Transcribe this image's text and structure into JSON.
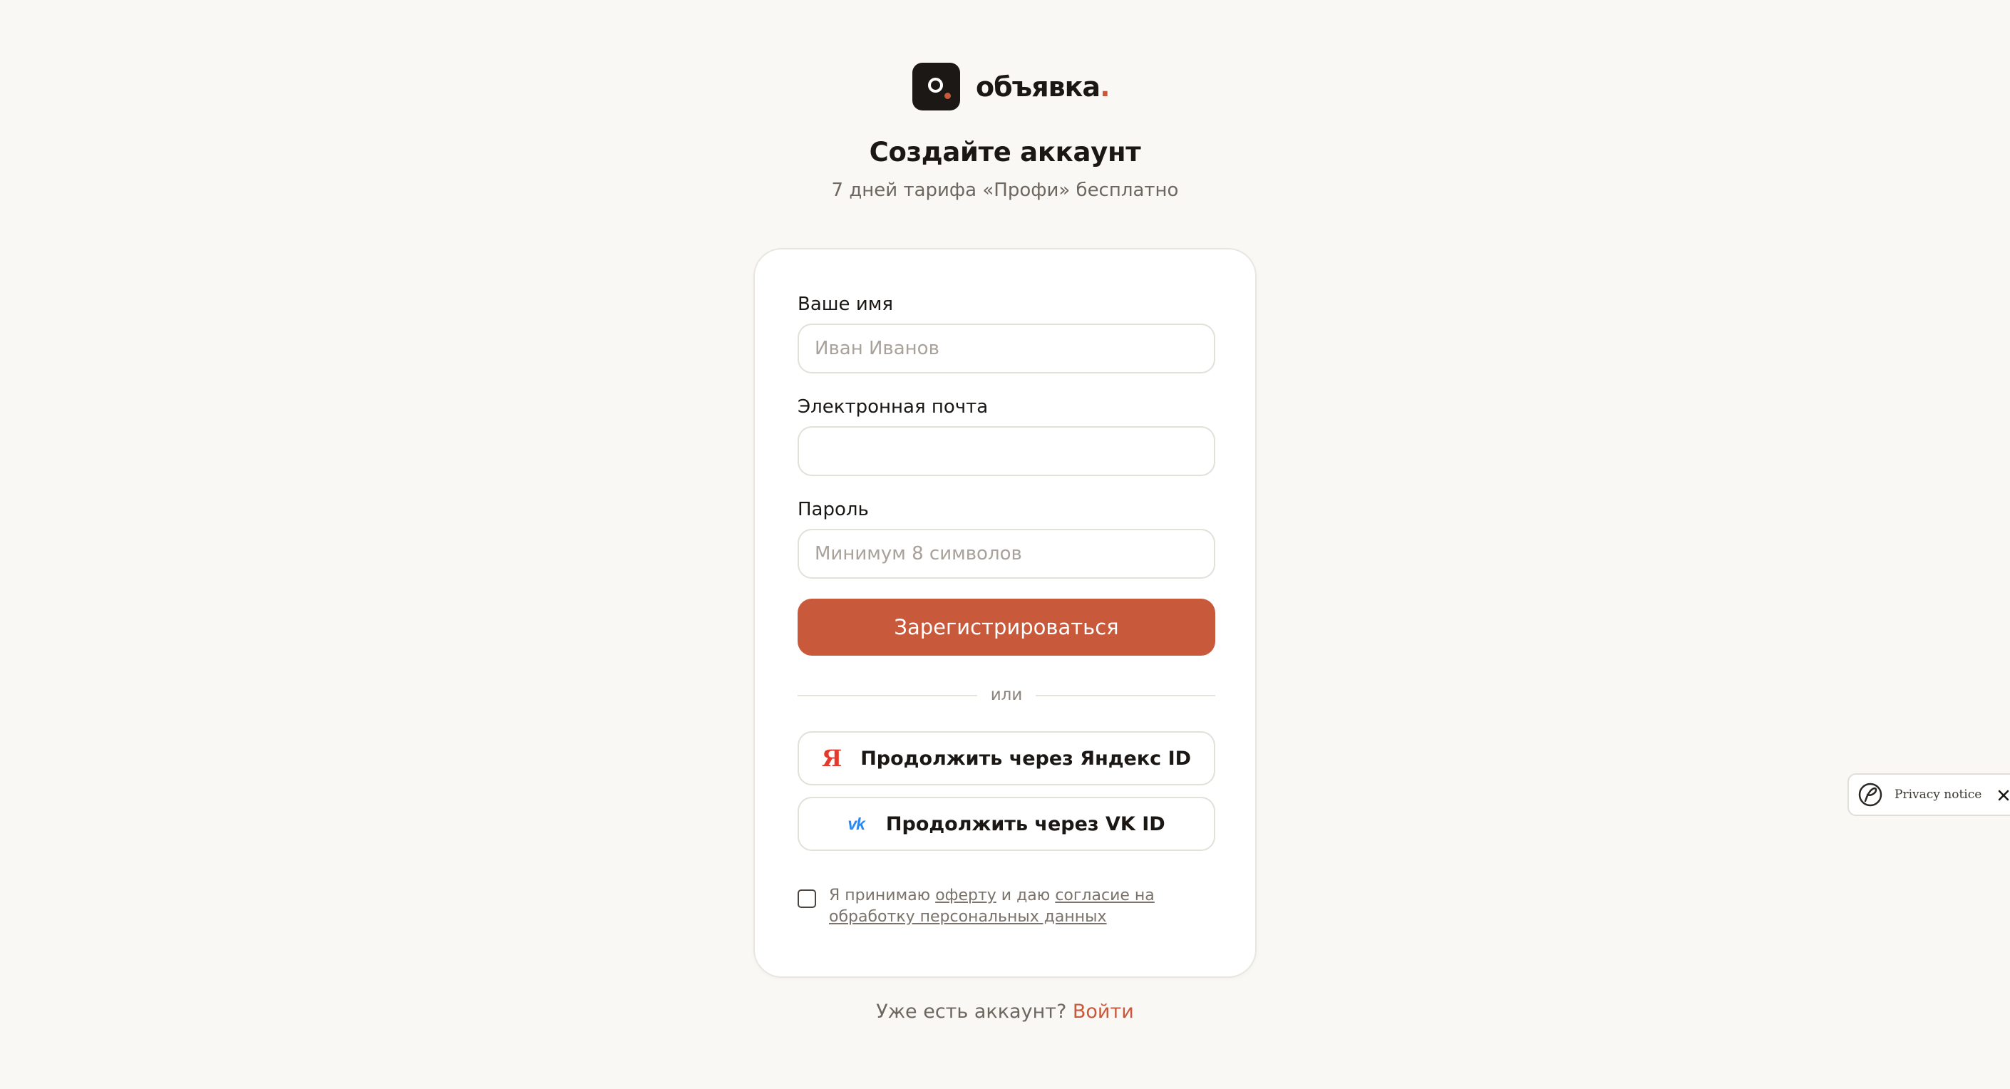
{
  "brand": {
    "name": "объявка",
    "accent_dot": ".",
    "accent_color": "#c8593b"
  },
  "header": {
    "title": "Создайте аккаунт",
    "subtitle": "7 дней тарифа «Профи» бесплатно"
  },
  "form": {
    "name": {
      "label": "Ваше имя",
      "placeholder": "Иван Иванов",
      "value": ""
    },
    "email": {
      "label": "Электронная почта",
      "placeholder": "",
      "value": ""
    },
    "password": {
      "label": "Пароль",
      "placeholder": "Минимум 8 символов",
      "value": ""
    },
    "submit_label": "Зарегистрироваться",
    "divider_text": "или",
    "yandex": {
      "icon": "Я",
      "label": "Продолжить через Яндекс ID"
    },
    "vk": {
      "icon": "vk",
      "label": "Продолжить через VK ID"
    },
    "consent": {
      "checked": false,
      "prefix": "Я принимаю ",
      "offer_link": "оферту",
      "middle": " и даю ",
      "consent_link": "согласие на обработку персональных данных"
    }
  },
  "footer": {
    "question": "Уже есть аккаунт?",
    "login_link": "Войти"
  },
  "privacy_widget": {
    "label": "Privacy notice",
    "close_icon": "close-icon"
  }
}
